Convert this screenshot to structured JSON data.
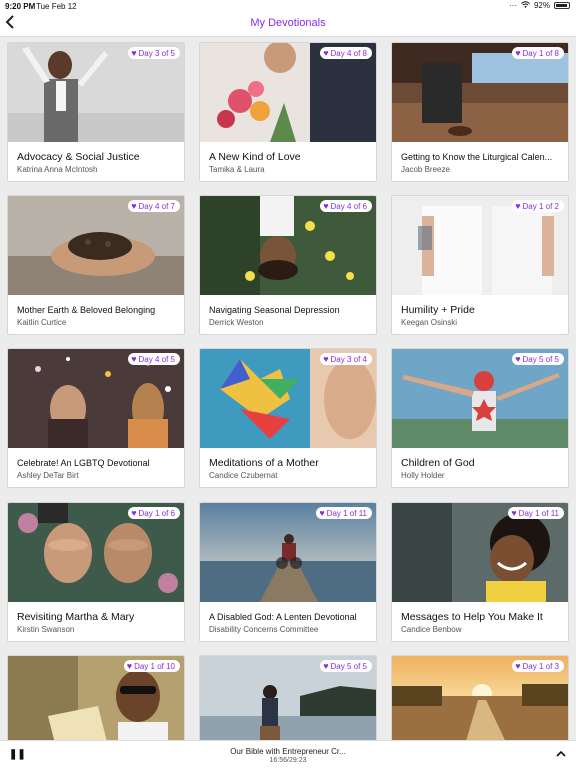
{
  "status": {
    "time": "9:20 PM",
    "date": "Tue Feb 12",
    "battery": "92%"
  },
  "nav": {
    "title": "My Devotionals",
    "back_icon": "chevron-left-icon"
  },
  "cards": [
    {
      "badge": "Day 3 of 5",
      "title": "Advocacy & Social Justice",
      "author": "Katrina Anna McIntosh"
    },
    {
      "badge": "Day 4 of 8",
      "title": "A New Kind of Love",
      "author": "Tamika & Laura"
    },
    {
      "badge": "Day 1 of 8",
      "title": "Getting to Know the Liturgical Calen...",
      "author": "Jacob Breeze"
    },
    {
      "badge": "Day 4 of 7",
      "title": "Mother Earth & Beloved Belonging",
      "author": "Kaitlin Curtice"
    },
    {
      "badge": "Day 4 of 6",
      "title": "Navigating Seasonal Depression",
      "author": "Derrick Weston"
    },
    {
      "badge": "Day 1 of 2",
      "title": "Humility + Pride",
      "author": "Keegan Osinski"
    },
    {
      "badge": "Day 4 of 5",
      "title": "Celebrate! An LGBTQ Devotional",
      "author": "Ashley DeTar Birt"
    },
    {
      "badge": "Day 3 of 4",
      "title": "Meditations of a Mother",
      "author": "Candice Czubernat"
    },
    {
      "badge": "Day 5 of 5",
      "title": "Children of God",
      "author": "Holly Holder"
    },
    {
      "badge": "Day 1 of 6",
      "title": "Revisiting Martha & Mary",
      "author": "Kirstin Swanson"
    },
    {
      "badge": "Day 1 of 11",
      "title": "A Disabled God: A Lenten Devotional",
      "author": "Disability Concerns Committee"
    },
    {
      "badge": "Day 1 of 11",
      "title": "Messages to Help You Make It",
      "author": "Candice Benbow"
    },
    {
      "badge": "Day 1 of 10",
      "title": "",
      "author": ""
    },
    {
      "badge": "Day 5 of 5",
      "title": "",
      "author": ""
    },
    {
      "badge": "Day 1 of 3",
      "title": "",
      "author": ""
    }
  ],
  "player": {
    "title": "Our Bible with Entrepreneur Cr...",
    "time": "16:56/29:23"
  }
}
